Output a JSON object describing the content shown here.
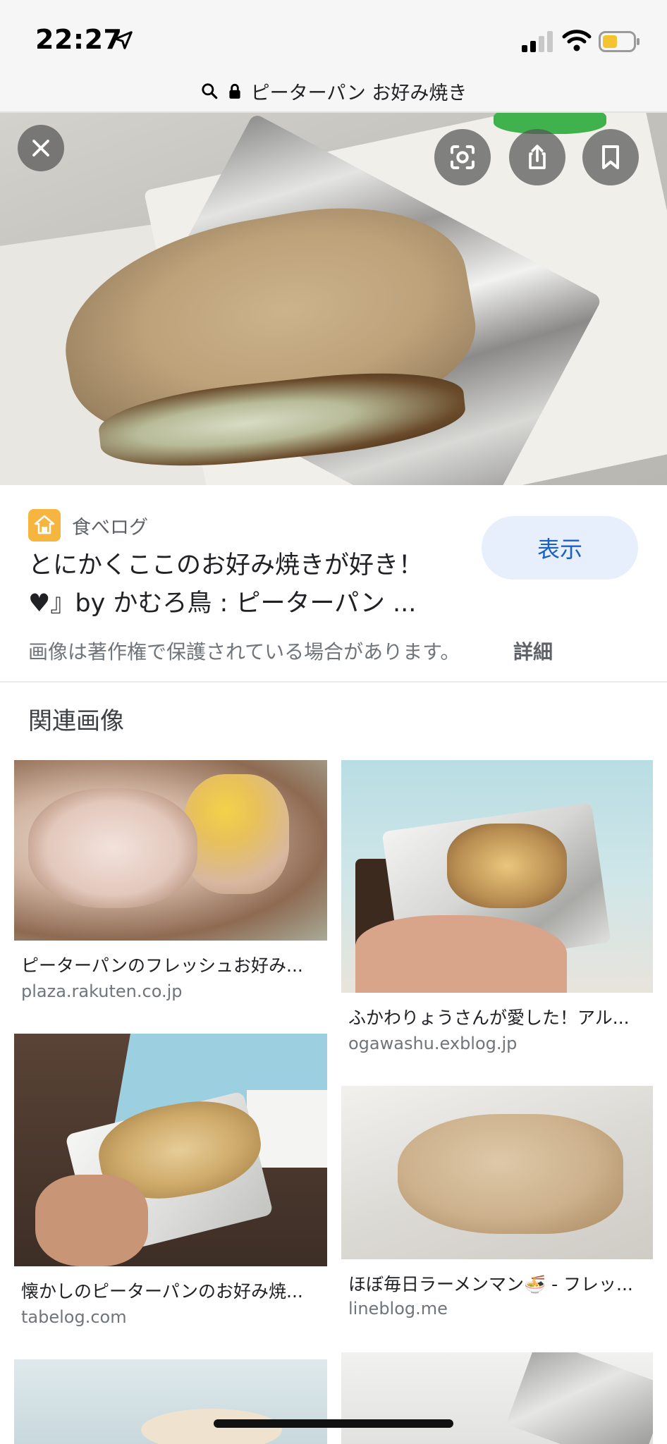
{
  "status": {
    "time": "22:27"
  },
  "urlbar": {
    "query": "ピーターパン お好み焼き"
  },
  "result": {
    "source_name": "食べログ",
    "title_line1": "とにかくここのお好み焼きが好き！",
    "title_line2": "♥』by かむろ鳥 : ピーターパン ...",
    "view_label": "表示",
    "copyright_notice": "画像は著作権で保護されている場合があります。",
    "details_label": "詳細"
  },
  "related": {
    "heading": "関連画像",
    "items": [
      {
        "caption": "ピーターパンのフレッシュお好み...",
        "domain": "plaza.rakuten.co.jp"
      },
      {
        "caption": "ふかわりょうさんが愛した！アル...",
        "domain": "ogawashu.exblog.jp"
      },
      {
        "caption": "懐かしのピーターパンのお好み焼...",
        "domain": "tabelog.com"
      },
      {
        "caption": "ほぼ毎日ラーメンマン🍜 - フレッ...",
        "domain": "lineblog.me"
      }
    ]
  }
}
